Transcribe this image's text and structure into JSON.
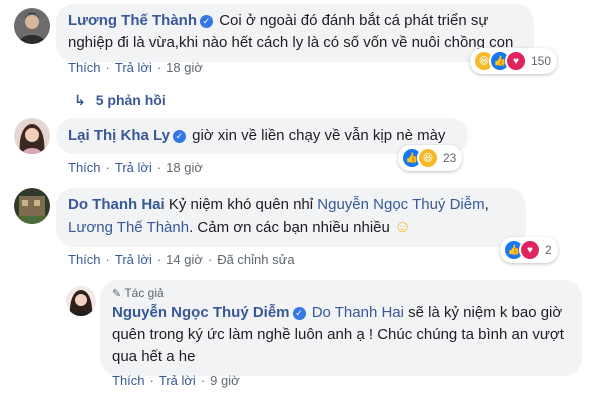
{
  "comments": [
    {
      "author": "Lương Thế Thành",
      "text": "Coi ở ngoài đó đánh bắt cá phát triển sự nghiệp đi là vừa,khi nào hết cách ly là có số vốn về nuôi chồng con",
      "actions": {
        "like": "Thích",
        "reply": "Trả lời",
        "time": "18 giờ"
      },
      "reaction_count": "150",
      "reactions": [
        "haha-icon",
        "like-icon",
        "love-icon"
      ]
    },
    {
      "author": "Lại Thị Kha Ly",
      "text": "giờ xin về liền chạy về vẫn kịp nè mày",
      "actions": {
        "like": "Thích",
        "reply": "Trả lời",
        "time": "18 giờ"
      },
      "reaction_count": "23",
      "reactions": [
        "like-icon",
        "haha-icon"
      ]
    },
    {
      "author": "Do Thanh Hai",
      "text_before": "Kỷ niệm khó quên nhỉ ",
      "mention1": "Nguyễn Ngọc Thuý Diễm",
      "sep": ", ",
      "mention2": "Lương Thế Thành",
      "text_after": ". Cảm ơn các bạn nhiều nhiều ",
      "emoji": "☺",
      "actions": {
        "like": "Thích",
        "reply": "Trả lời",
        "time": "14 giờ",
        "edited": "Đã chỉnh sửa"
      },
      "reaction_count": "2",
      "reactions": [
        "like-icon",
        "love-icon"
      ]
    }
  ],
  "replies_link": {
    "label": "5 phản hồi"
  },
  "reply": {
    "badge": "Tác giả",
    "author": "Nguyễn Ngọc Thuý Diễm",
    "mention": "Do Thanh Hai",
    "text": " sẽ là kỷ niệm k bao giờ quên trong ký ức làm nghề luôn anh ạ ! Chúc chúng ta bình an vượt qua hết a he",
    "actions": {
      "like": "Thích",
      "reply": "Trả lời",
      "time": "9 giờ"
    }
  }
}
